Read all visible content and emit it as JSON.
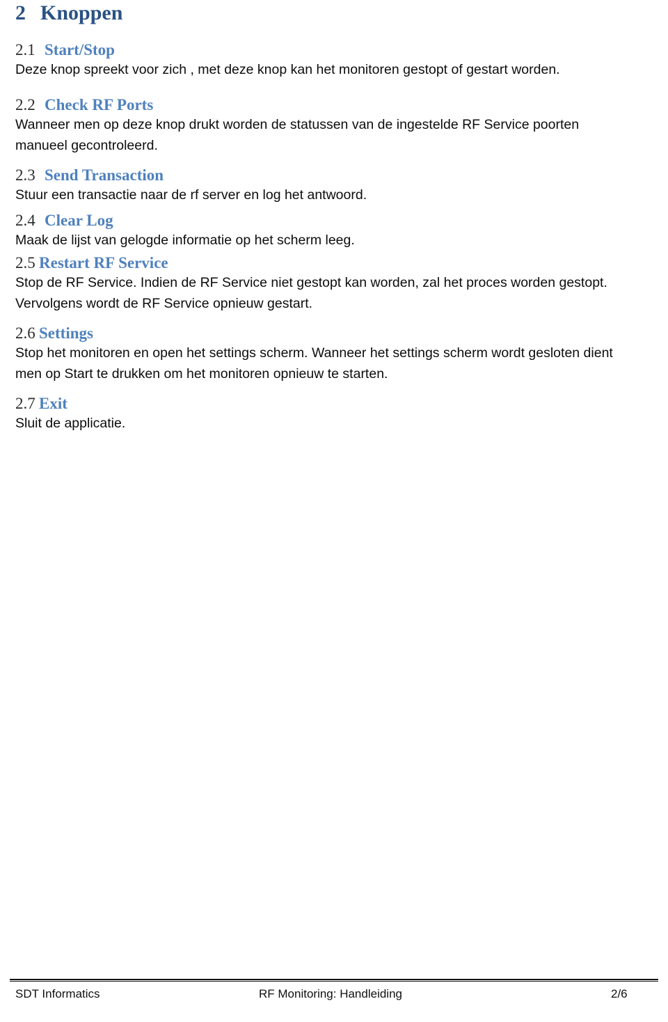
{
  "document": {
    "title": "RF Monitoring: Handleiding",
    "language": "nl"
  },
  "colors": {
    "h1": "#2a5284",
    "h2_title": "#4f81bd",
    "h2_number": "#2d2d2d",
    "body": "#0d0d0d",
    "rule": "#111111",
    "background": "#ffffff"
  },
  "chapter": {
    "number": "2",
    "title": "Knoppen"
  },
  "sections": [
    {
      "number": "2.1",
      "title": "Start/Stop",
      "paragraphs": [
        "Deze knop spreekt voor zich , met deze knop kan het monitoren gestopt of gestart worden."
      ]
    },
    {
      "number": "2.2",
      "title": "Check RF Ports",
      "paragraphs": [
        "Wanneer men op deze knop drukt worden de statussen van de ingestelde RF Service poorten manueel gecontroleerd."
      ]
    },
    {
      "number": "2.3",
      "title": "Send Transaction",
      "paragraphs": [
        "Stuur een transactie naar de rf server en log het antwoord."
      ]
    },
    {
      "number": "2.4",
      "title": "Clear Log",
      "paragraphs": [
        "Maak de lijst van gelogde informatie op het scherm leeg."
      ]
    },
    {
      "number": "2.5",
      "title": "Restart RF Service",
      "paragraphs": [
        "Stop de RF Service. Indien de RF Service niet gestopt kan worden, zal het proces worden gestopt. Vervolgens wordt de RF Service opnieuw gestart."
      ]
    },
    {
      "number": "2.6",
      "title": "Settings",
      "paragraphs": [
        "Stop het monitoren en open het settings scherm. Wanneer het settings scherm wordt gesloten dient men op Start te drukken om het monitoren opnieuw te starten."
      ]
    },
    {
      "number": "2.7",
      "title": "Exit",
      "paragraphs": [
        "Sluit de applicatie."
      ]
    }
  ],
  "footer": {
    "left": "SDT Informatics",
    "center": "RF Monitoring: Handleiding",
    "right": "2/6"
  }
}
